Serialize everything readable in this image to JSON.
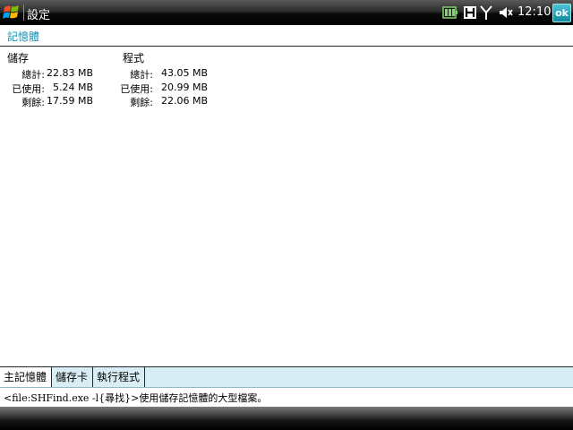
{
  "titlebar": {
    "app_title": "設定",
    "time": "12:10",
    "ok_label": "ok",
    "icons": [
      "windows-logo-icon",
      "battery-icon",
      "h-network-icon",
      "signal-antenna-icon",
      "volume-icon"
    ]
  },
  "page": {
    "title": "記憶體"
  },
  "storage": {
    "heading": "儲存",
    "rows": [
      {
        "label": "總計:",
        "value": "22.83 MB"
      },
      {
        "label": "已使用:",
        "value": "5.24 MB"
      },
      {
        "label": "剩餘:",
        "value": "17.59 MB"
      }
    ]
  },
  "program": {
    "heading": "程式",
    "rows": [
      {
        "label": "總計:",
        "value": "43.05 MB"
      },
      {
        "label": "已使用:",
        "value": "20.99 MB"
      },
      {
        "label": "剩餘:",
        "value": "22.06 MB"
      }
    ]
  },
  "tabs": [
    {
      "label": "主記憶體",
      "active": true
    },
    {
      "label": "儲存卡",
      "active": false
    },
    {
      "label": "執行程式",
      "active": false
    }
  ],
  "help_text": "<file:SHFind.exe -l{尋找}>使用儲存記憶體的大型檔案。",
  "colors": {
    "accent": "#1a8fb0",
    "tab_bg": "#d8eef4",
    "ok_button": "#1aa0b4"
  }
}
